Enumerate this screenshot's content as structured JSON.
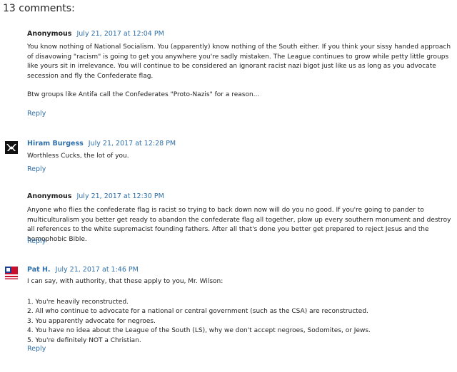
{
  "heading": "13 comments:",
  "comments": [
    {
      "author": "Anonymous",
      "timestamp": "July 21, 2017 at 12:04 PM",
      "paragraphs": [
        "You know nothing of National Socialism. You (apparently) know nothing of the South either. If you think your sissy handed approach of disavowing \"racism\" is going to get you anywhere you're sadly mistaken. The League continues to grow while petty little groups like yours sit in irrelevance. You will continue to be considered an ignorant racist nazi bigot just like us as long as you advocate secession and fly the Confederate flag.",
        "Btw groups like Antifa call the Confederates \"Proto-Nazis\" for a reason..."
      ],
      "reply": "Reply"
    },
    {
      "author": "Hiram Burgess",
      "timestamp": "July 21, 2017 at 12:28 PM",
      "paragraphs": [
        "Worthless Cucks, the lot of you."
      ],
      "reply": "Reply"
    },
    {
      "author": "Anonymous",
      "timestamp": "July 21, 2017 at 12:30 PM",
      "paragraphs": [
        "Anyone who flies the confederate flag is racist so trying to back down now will do you no good. If you're going to pander to multiculturalism you better get ready to abandon the confederate flag all together, plow up every southern monument and destroy all references to the white supremacist founding fathers. After all that's done you better get prepared to reject Jesus and the homophobic Bible."
      ],
      "reply": "Reply"
    },
    {
      "author": "Pat H.",
      "timestamp": "July 21, 2017 at 1:46 PM",
      "intro": "I can say, with authority, that these apply to you, Mr. Wilson:",
      "list": [
        "1. You're heavily reconstructed.",
        "2. All who continue to advocate for a national or central government (such as the CSA) are reconstructed.",
        "3. You apparently advocate for negroes.",
        "4. You have no idea about the League of the South (LS), why we don't accept negroes, Sodomites, or Jews.",
        "5. You're definitely NOT a Christian."
      ],
      "reply": "Reply"
    }
  ]
}
